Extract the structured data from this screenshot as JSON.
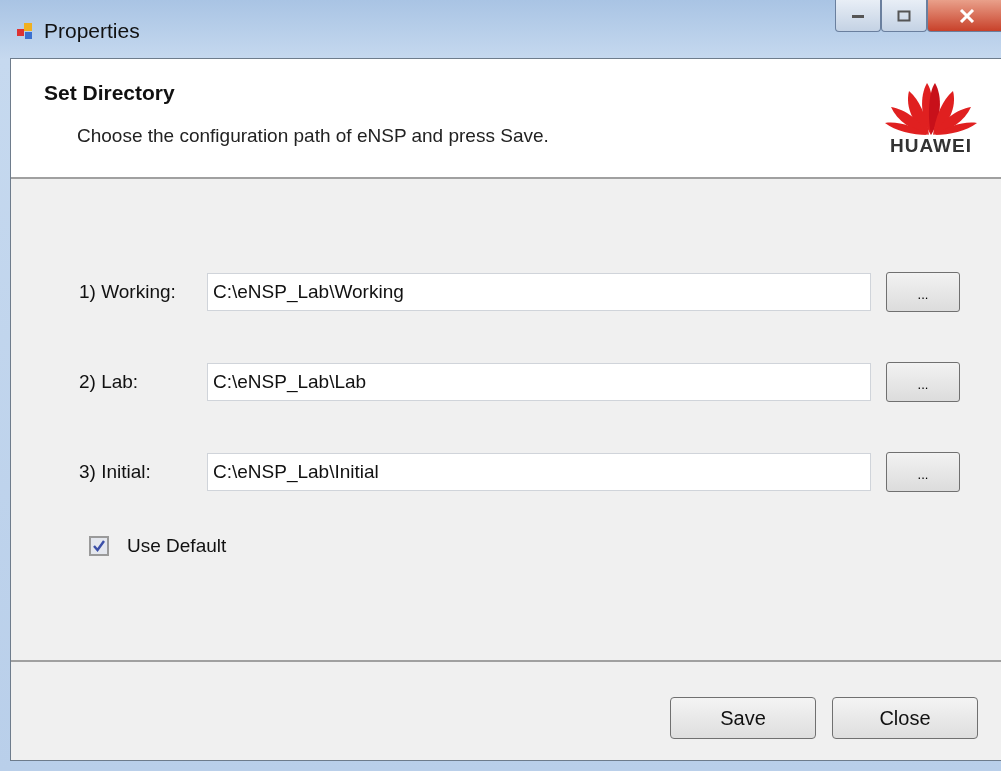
{
  "window": {
    "title": "Properties"
  },
  "header": {
    "title": "Set Directory",
    "subtitle": "Choose the configuration path of eNSP and press Save.",
    "logo_text": "HUAWEI"
  },
  "paths": [
    {
      "label": "1) Working:",
      "value": "C:\\eNSP_Lab\\Working",
      "browse": "..."
    },
    {
      "label": "2) Lab:",
      "value": "C:\\eNSP_Lab\\Lab",
      "browse": "..."
    },
    {
      "label": "3) Initial:",
      "value": "C:\\eNSP_Lab\\Initial",
      "browse": "..."
    }
  ],
  "use_default": {
    "label": "Use Default",
    "checked": true
  },
  "buttons": [
    "Save",
    "Close"
  ]
}
